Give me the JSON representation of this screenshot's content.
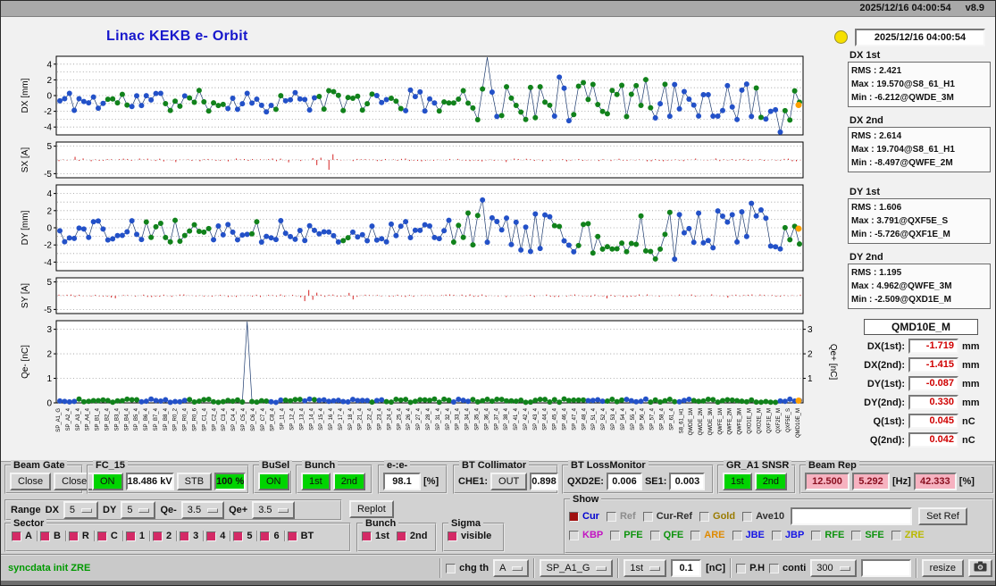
{
  "titlebar": {
    "datetime": "2025/12/16 04:00:54",
    "version": "v8.9"
  },
  "header": {
    "title": "Linac KEKB e- Orbit",
    "timestamp": "2025/12/16 04:00:54"
  },
  "stats": [
    {
      "name": "DX 1st",
      "rms": "RMS : 2.421",
      "max": "Max : 19.570@S8_61_H1",
      "min": "Min : -6.212@QWDE_3M"
    },
    {
      "name": "DX 2nd",
      "rms": "RMS : 2.614",
      "max": "Max : 19.704@S8_61_H1",
      "min": "Min : -8.497@QWFE_2M"
    },
    {
      "name": "DY 1st",
      "rms": "RMS : 1.606",
      "max": "Max : 3.791@QXF5E_S",
      "min": "Min : -5.726@QXF1E_M"
    },
    {
      "name": "DY 2nd",
      "rms": "RMS : 1.195",
      "max": "Max : 4.962@QWFE_3M",
      "min": "Min : -2.509@QXD1E_M"
    }
  ],
  "monitor": {
    "title": "QMD10E_M",
    "rows": [
      {
        "label": "DX(1st):",
        "value": "-1.719",
        "unit": "mm"
      },
      {
        "label": "DX(2nd):",
        "value": "-1.415",
        "unit": "mm"
      },
      {
        "label": "DY(1st):",
        "value": "-0.087",
        "unit": "mm"
      },
      {
        "label": "DY(2nd):",
        "value": "0.330",
        "unit": "mm"
      },
      {
        "label": "Q(1st):",
        "value": "0.045",
        "unit": "nC"
      },
      {
        "label": "Q(2nd):",
        "value": "0.042",
        "unit": "nC"
      }
    ]
  },
  "chart_data": [
    {
      "id": "dx",
      "type": "scatter",
      "ylabel": "DX [mm]",
      "ylim": [
        -5,
        5
      ],
      "yticks": [
        4,
        2,
        0,
        -2,
        -4
      ],
      "grid": [
        4,
        3,
        2,
        1,
        0,
        -1,
        -2,
        -3,
        -4
      ],
      "n": 155,
      "mean": -0.7,
      "amp": 1.4,
      "wild": 1.7,
      "dip_p": 0.09,
      "up_p": 0.07,
      "toggle_p": 0.14,
      "seed": 11,
      "spike_at": 0.578,
      "spike_y": 30,
      "end_dot": -1.2,
      "line_color": "#1c3a6e",
      "series": [
        {
          "name": "1st",
          "color": "#2351c8"
        },
        {
          "name": "2nd",
          "color": "#11821b"
        }
      ]
    },
    {
      "id": "sx",
      "type": "bars",
      "ylabel": "SX [A]",
      "ylim": [
        -6.5,
        6.5
      ],
      "yticks": [
        5,
        -5
      ],
      "grid": [
        5,
        0,
        -5
      ],
      "n": 185,
      "amp": 0.55,
      "burst_at": 0.355,
      "burst_gain": 7,
      "rand_p": 0.05,
      "rand_gain": 3,
      "seed": 23,
      "color": "#d42222"
    },
    {
      "id": "dy",
      "type": "scatter",
      "ylabel": "DY [mm]",
      "ylim": [
        -5,
        5
      ],
      "yticks": [
        4,
        2,
        0,
        -2,
        -4
      ],
      "grid": [
        4,
        3,
        2,
        1,
        0,
        -1,
        -2,
        -3,
        -4
      ],
      "n": 155,
      "mean": -0.4,
      "amp": 1.3,
      "wild": 2.0,
      "dip_p": 0.1,
      "up_p": 0.08,
      "toggle_p": 0.14,
      "seed": 37,
      "end_dot": -0.1,
      "line_color": "#1c3a6e",
      "series": [
        {
          "name": "1st",
          "color": "#2351c8"
        },
        {
          "name": "2nd",
          "color": "#11821b"
        }
      ]
    },
    {
      "id": "sy",
      "type": "bars",
      "ylabel": "SY [A]",
      "ylim": [
        -6.5,
        6.5
      ],
      "yticks": [
        5,
        -5
      ],
      "grid": [
        5,
        0,
        -5
      ],
      "n": 185,
      "amp": 0.5,
      "burst_at": 0.335,
      "burst_gain": 7.5,
      "rand_p": 0.04,
      "rand_gain": 3,
      "seed": 41,
      "color": "#d42222"
    },
    {
      "id": "qe",
      "type": "scatter",
      "flat": true,
      "ylabel": "Qe- [nC]",
      "ylabel_right": "Qe+ [nC]",
      "ylim": [
        0,
        3.35
      ],
      "yticks": [
        3,
        2,
        1,
        0
      ],
      "yticks_right": [
        3,
        2,
        1
      ],
      "grid": [
        3,
        2,
        1
      ],
      "n": 155,
      "mean": 0.09,
      "amp": 0.07,
      "toggle_p": 0.1,
      "seed": 59,
      "spike_at": 0.253,
      "spike_y": 20,
      "end_dot": 0.09,
      "line_color": "#1c3a6e",
      "series": [
        {
          "name": "1st",
          "color": "#2351c8"
        },
        {
          "name": "2nd",
          "color": "#11821b"
        }
      ]
    }
  ],
  "bpm_labels": [
    "SP_A1_G",
    "SP_A2_4",
    "SP_A3_4",
    "SP_A4_4",
    "SP_B1_4",
    "SP_B2_4",
    "SP_B3_4",
    "SP_B4_4",
    "SP_B5_4",
    "SP_B6_4",
    "SP_B7_4",
    "SP_B8_4",
    "SP_R0_2",
    "SP_R0_4",
    "SP_R0_6",
    "SP_C1_4",
    "SP_C2_4",
    "SP_C3_4",
    "SP_C4_4",
    "SP_C5_4",
    "SP_C6_4",
    "SP_C7_4",
    "SP_C8_4",
    "SP_11_4",
    "SP_12_4",
    "SP_13_4",
    "SP_14_4",
    "SP_15_4",
    "SP_16_4",
    "SP_17_4",
    "SP_18_4",
    "SP_21_4",
    "SP_22_4",
    "SP_23_4",
    "SP_24_4",
    "SP_25_4",
    "SP_26_4",
    "SP_27_4",
    "SP_28_4",
    "SP_31_4",
    "SP_32_4",
    "SP_33_4",
    "SP_34_4",
    "SP_35_4",
    "SP_36_4",
    "SP_37_4",
    "SP_38_4",
    "SP_41_4",
    "SP_42_4",
    "SP_43_4",
    "SP_44_4",
    "SP_45_4",
    "SP_46_4",
    "SP_47_4",
    "SP_48_4",
    "SP_51_4",
    "SP_52_4",
    "SP_53_4",
    "SP_54_4",
    "SP_55_4",
    "SP_56_4",
    "SP_57_4",
    "SP_58_4",
    "SP_61_4",
    "S8_61_H1",
    "QWDE_1M",
    "QWDE_2M",
    "QWDE_3M",
    "QWFE_1M",
    "QWFE_2M",
    "QWFE_3M",
    "QXD1E_M",
    "QXD2E_M",
    "QXF1E_M",
    "QXF2E_M",
    "QXF5E_S",
    "QMD10E_M"
  ],
  "panels": {
    "beam_gate": {
      "label": "Beam Gate",
      "b1": "Close",
      "b2": "Close"
    },
    "fc15": {
      "label": "FC_15",
      "on": "ON",
      "kv": "18.486 kV",
      "stb": "STB",
      "duty": "100 %"
    },
    "busel": {
      "label": "BuSel",
      "on": "ON"
    },
    "bunch": {
      "label": "Bunch",
      "b1": "1st",
      "b2": "2nd"
    },
    "ee": {
      "label": "e-:e-",
      "value": "98.1",
      "unit": "[%]"
    },
    "bt_collimator": {
      "label": "BT Collimator",
      "che1": "CHE1:",
      "state": "OUT",
      "value": "0.898"
    },
    "bt_loss": {
      "label": "BT LossMonitor",
      "l1": "QXD2E:",
      "v1": "0.006",
      "l2": "SE1:",
      "v2": "0.003"
    },
    "gr_snsr": {
      "label": "GR_A1 SNSR",
      "b1": "1st",
      "b2": "2nd"
    },
    "beam_rep": {
      "label": "Beam Rep",
      "v1": "12.500",
      "v2": "5.292",
      "hz": "[Hz]",
      "v3": "42.333",
      "pct": "[%]"
    }
  },
  "range_row": {
    "title": "Range",
    "dx_label": "DX",
    "dx": "5",
    "dy_label": "DY",
    "dy": "5",
    "qem_label": "Qe-",
    "qem": "3.5",
    "qep_label": "Qe+",
    "qep": "3.5",
    "replot": "Replot"
  },
  "sector": {
    "label": "Sector",
    "items": [
      {
        "label": "A",
        "checked": true,
        "check_color": "#d42a66"
      },
      {
        "label": "B",
        "checked": true,
        "check_color": "#d42a66"
      },
      {
        "label": "R",
        "checked": true,
        "check_color": "#d42a66"
      },
      {
        "label": "C",
        "checked": true,
        "check_color": "#d42a66"
      },
      {
        "label": "1",
        "checked": true,
        "check_color": "#d42a66"
      },
      {
        "label": "2",
        "checked": true,
        "check_color": "#d42a66"
      },
      {
        "label": "3",
        "checked": true,
        "check_color": "#d42a66"
      },
      {
        "label": "4",
        "checked": true,
        "check_color": "#d42a66"
      },
      {
        "label": "5",
        "checked": true,
        "check_color": "#d42a66"
      },
      {
        "label": "6",
        "checked": true,
        "check_color": "#d42a66"
      },
      {
        "label": "BT",
        "checked": true,
        "check_color": "#d42a66"
      }
    ]
  },
  "bunch_sel": {
    "label": "Bunch",
    "items": [
      {
        "label": "1st",
        "checked": true,
        "check_color": "#d42a66"
      },
      {
        "label": "2nd",
        "checked": true,
        "check_color": "#d42a66"
      }
    ]
  },
  "sigma": {
    "label": "Sigma",
    "items": [
      {
        "label": "visible",
        "checked": true,
        "check_color": "#d42a66"
      }
    ]
  },
  "show": {
    "label": "Show",
    "row1": [
      {
        "label": "Cur",
        "color": "#0000d0",
        "checked": true,
        "check_color": "#a01010"
      },
      {
        "label": "Ref",
        "color": "#8c8c8c",
        "checked": false
      },
      {
        "label": "Cur-Ref",
        "color": "#303030",
        "checked": false
      },
      {
        "label": "Gold",
        "color": "#9a7b00",
        "checked": false
      },
      {
        "label": "Ave10",
        "color": "#303030",
        "checked": false
      }
    ],
    "ref_input": "",
    "set_ref": "Set Ref",
    "row2": [
      {
        "label": "KBP",
        "color": "#c213c2",
        "checked": false
      },
      {
        "label": "PFE",
        "color": "#0d930d",
        "checked": false
      },
      {
        "label": "QFE",
        "color": "#0d930d",
        "checked": false
      },
      {
        "label": "ARE",
        "color": "#df8a00",
        "checked": false
      },
      {
        "label": "JBE",
        "color": "#1414e6",
        "checked": false
      },
      {
        "label": "JBP",
        "color": "#1414e6",
        "checked": false
      },
      {
        "label": "RFE",
        "color": "#0d930d",
        "checked": false
      },
      {
        "label": "SFE",
        "color": "#0d930d",
        "checked": false
      },
      {
        "label": "ZRE",
        "color": "#b9b900",
        "checked": false
      }
    ]
  },
  "statusbar": {
    "message": "syncdata init ZRE",
    "chg_th": "chg th",
    "sel_a": "A",
    "sel_sp": "SP_A1_G",
    "sel_bunch": "1st",
    "threshold": "0.1",
    "unit": "[nC]",
    "ph": "P.H",
    "conti": "conti",
    "interval": "300",
    "free_input": "",
    "resize": "resize"
  }
}
